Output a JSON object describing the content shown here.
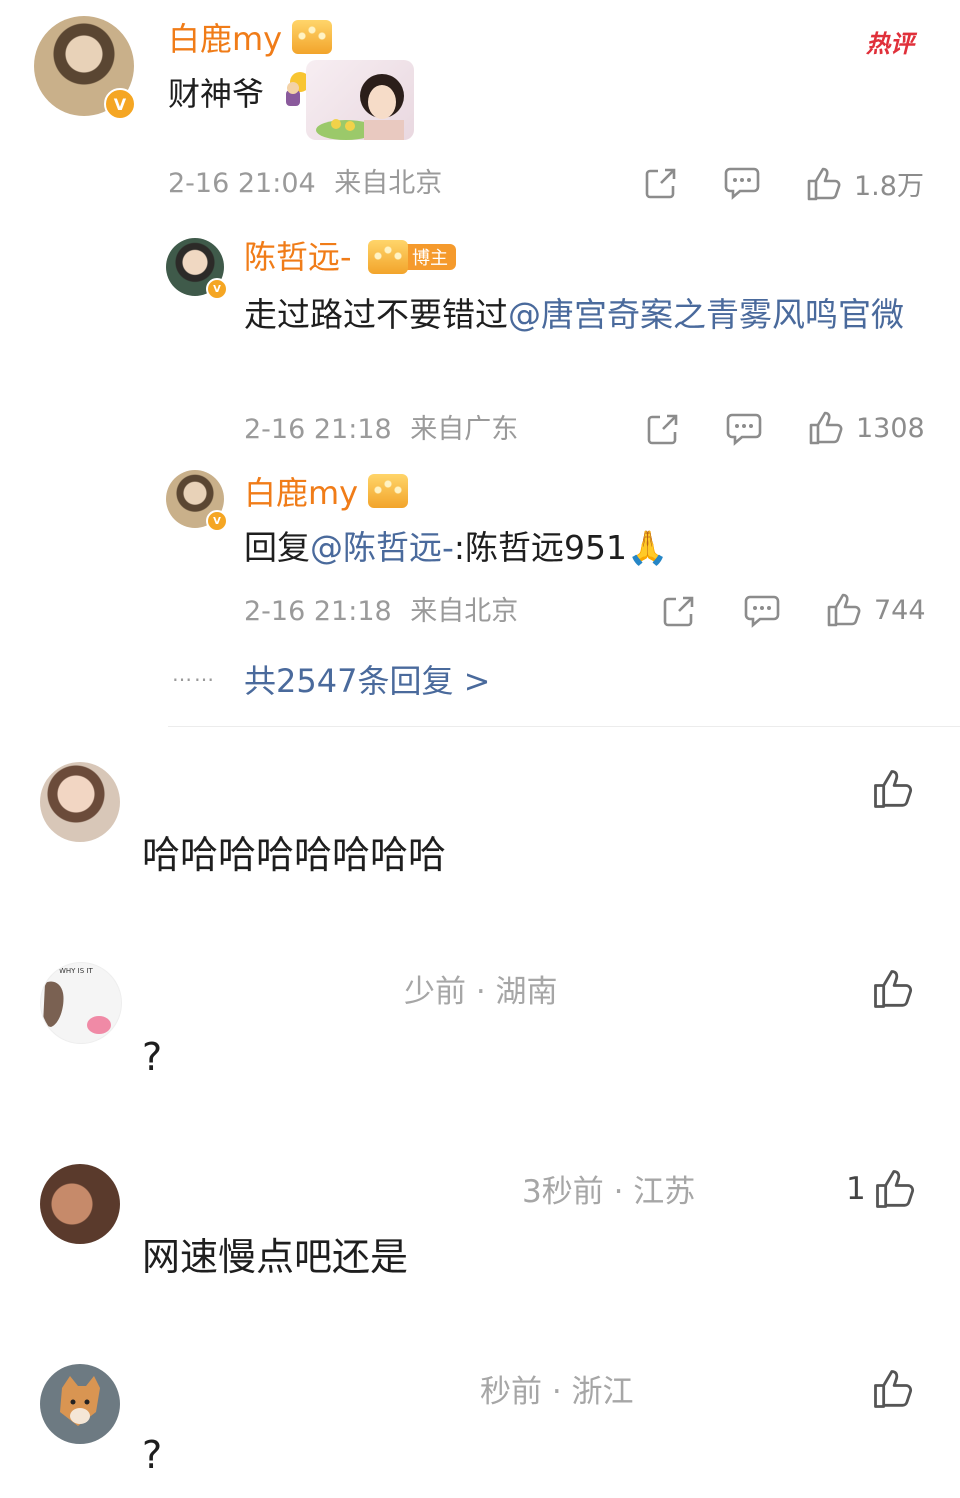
{
  "colors": {
    "accent_orange": "#f07c18",
    "link_blue": "#4a6a9c",
    "meta_gray": "#9a9a9a",
    "hot_red": "#e0303a"
  },
  "main_comment": {
    "author": "白鹿my",
    "text": "财神爷",
    "time": "2-16 21:04",
    "location": "来自北京",
    "likes": "1.8万",
    "hot_badge": "热评"
  },
  "replies": [
    {
      "author": "陈哲远-",
      "badge": "博主",
      "text": "走过路过不要错过",
      "mention": "@唐宫奇案之青雾风鸣官微",
      "time": "2-16 21:18",
      "location": "来自广东",
      "likes": "1308"
    },
    {
      "author": "白鹿my",
      "prefix": "回复",
      "mention": "@陈哲远-",
      "text": ":陈哲远951🙏",
      "time": "2-16 21:18",
      "location": "来自北京",
      "likes": "744"
    }
  ],
  "more_replies": {
    "dots": "……",
    "label": "共2547条回复 >"
  },
  "comments": [
    {
      "text": "哈哈哈哈哈哈哈哈",
      "meta": "",
      "likes": ""
    },
    {
      "text": "?",
      "meta": "少前 · 湖南",
      "likes": ""
    },
    {
      "text": "网速慢点吧还是",
      "meta": "3秒前 · 江苏",
      "likes": "1"
    },
    {
      "text": "?",
      "meta": "秒前 · 浙江",
      "likes": ""
    }
  ],
  "icons": {
    "share": "share-icon",
    "comment": "comment-icon",
    "like": "thumbs-up-icon"
  }
}
